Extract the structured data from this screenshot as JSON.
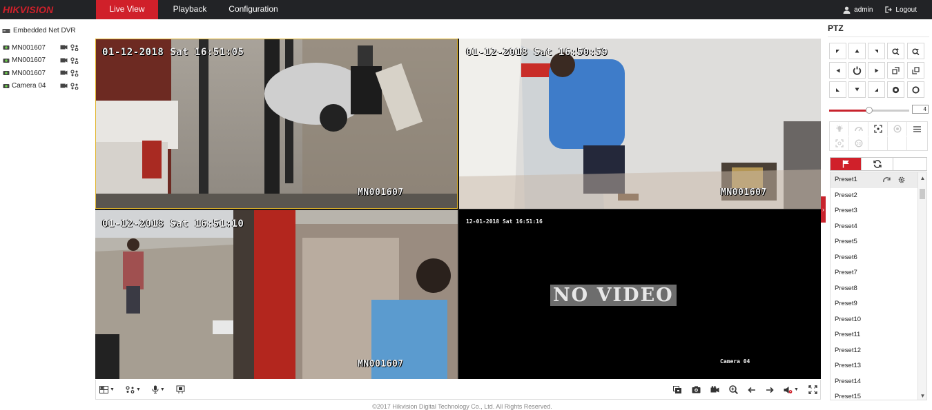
{
  "brand": {
    "logo_text": "HIKVISION",
    "accent": "#d0202a"
  },
  "nav": {
    "tabs": [
      "Live View",
      "Playback",
      "Configuration"
    ],
    "active": "Live View"
  },
  "user": {
    "name": "admin",
    "logout_label": "Logout"
  },
  "tree": {
    "root_label": "Embedded Net DVR",
    "cameras": [
      "MN001607",
      "MN001607",
      "MN001607",
      "Camera 04"
    ]
  },
  "video": {
    "tiles": [
      {
        "timestamp": "01-12-2018 Sat 16:51:05",
        "channel_label": "MN001607",
        "selected": true
      },
      {
        "timestamp": "01-12-2018 Sat 16:50:59",
        "channel_label": "MN001607",
        "selected": false
      },
      {
        "timestamp": "01-12-2018 Sat 16:51:10",
        "channel_label": "MN001607",
        "selected": false
      },
      {
        "timestamp": "12-01-2018 Sat 16:51:16",
        "channel_label": "Camera 04",
        "no_video_text": "NO VIDEO",
        "selected": false
      }
    ]
  },
  "toolbar": {
    "left_icons": [
      "layout-grid-icon",
      "ptz-icon",
      "microphone-icon",
      "digital-zoom-icon"
    ],
    "right_icons": [
      "stop-all-icon",
      "capture-icon",
      "record-icon",
      "zoom-in-icon",
      "prev-page-icon",
      "next-page-icon",
      "volume-icon",
      "fullscreen-icon"
    ]
  },
  "footer": {
    "copyright": "©2017 Hikvision Digital Technology Co., Ltd. All Rights Reserved."
  },
  "ptz": {
    "title": "PTZ",
    "speed": {
      "value": "4",
      "min": 1,
      "max": 7
    },
    "presets": [
      "Preset1",
      "Preset2",
      "Preset3",
      "Preset4",
      "Preset5",
      "Preset6",
      "Preset7",
      "Preset8",
      "Preset9",
      "Preset10",
      "Preset11",
      "Preset12",
      "Preset13",
      "Preset14",
      "Preset15"
    ],
    "highlighted_preset": "Preset1"
  }
}
